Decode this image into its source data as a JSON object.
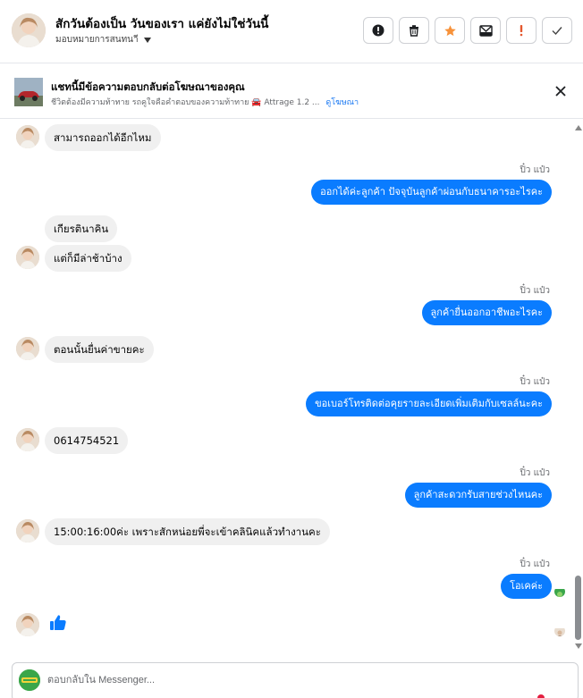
{
  "header": {
    "title": "สักวันต้องเป็น วันของเรา แค่ยังไม่ใช่วันนี้",
    "assign_label": "มอบหมายการสนทนาี",
    "actions": [
      {
        "icon": "alert-circle-icon",
        "label": "ทำเครื่องหมายว่ายังไม่ได้อ่าน"
      },
      {
        "icon": "trash-icon",
        "label": "ลบ"
      },
      {
        "icon": "star-icon",
        "label": "ติดดาว"
      },
      {
        "icon": "archive-icon",
        "label": "ย้ายไปที่เสร็จสิ้น"
      },
      {
        "icon": "exclamation-icon",
        "label": "สแปม"
      },
      {
        "icon": "check-icon",
        "label": "เสร็จสิ้น"
      }
    ]
  },
  "ad": {
    "title": "แชทนี้มีข้อความตอบกลับต่อโฆษณาของคุณ",
    "description": "ชีวิตต้องมีความท้าทาย รถคูใจคือคำตอบของความท้าทาย 🚘 Attrage 1.2 ...",
    "link": "ดูโฆษณา"
  },
  "messages": [
    {
      "dir": "in",
      "text": "สามารถออกได้อีกไหม"
    },
    {
      "dir": "out",
      "sender": "ปิ๋ว แป๋ว",
      "text": "ออกได้ค่ะลูกค้า  ปัจจุบันลูกค้าผ่อนกับธนาคารอะไรคะ"
    },
    {
      "dir": "in",
      "text": "เกียรตินาคิน"
    },
    {
      "dir": "in",
      "text": "แต่ก็มีล่าช้าบ้าง"
    },
    {
      "dir": "out",
      "sender": "ปิ๋ว แป๋ว",
      "text": "ลูกค้ายื่นออกอาชีพอะไรคะ"
    },
    {
      "dir": "in",
      "text": "ตอนนั้นยื่นค่าขายคะ"
    },
    {
      "dir": "out",
      "sender": "ปิ๋ว แป๋ว",
      "text": "ขอเบอร์โทรติดต่อคุยรายละเอียดเพิ่มเติมกับเซลล์นะคะ"
    },
    {
      "dir": "in",
      "text": "0614754521"
    },
    {
      "dir": "out",
      "sender": "ปิ๋ว แป๋ว",
      "text": "ลูกค้าสะดวกรับสายช่วงไหนคะ"
    },
    {
      "dir": "in",
      "text": "15:00:16:00ค่ะ เพราะสักหน่อยพี่จะเข้าคลินิคแล้วทำงานคะ"
    },
    {
      "dir": "out",
      "sender": "ปิ๋ว แป๋ว",
      "text": "โอเคค่ะ"
    },
    {
      "dir": "in",
      "type": "like",
      "icon": "thumbs-up-icon"
    }
  ],
  "composer": {
    "placeholder": "ตอบกลับใน Messenger..."
  },
  "colors": {
    "accent": "#0a7cff",
    "incoming_bubble": "#f0f0f0",
    "star": "#f7923a",
    "spam": "#e4572e"
  }
}
